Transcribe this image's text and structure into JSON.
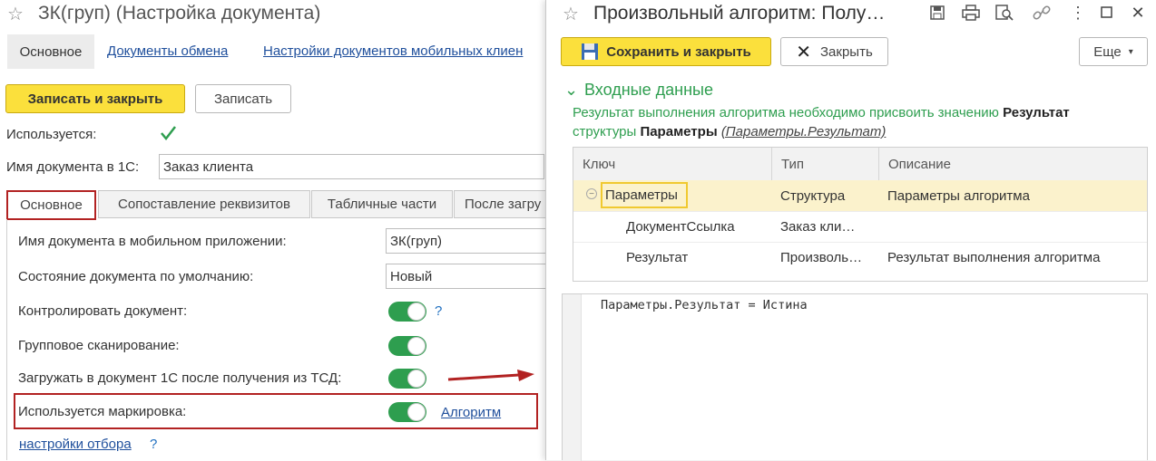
{
  "left": {
    "title": "ЗК(груп) (Настройка документа)",
    "top_tabs": [
      "Основное",
      "Документы обмена",
      "Настройки документов мобильных клиен"
    ],
    "buttons": {
      "save_close": "Записать и закрыть",
      "save": "Записать"
    },
    "used_label": "Используется:",
    "docname_label": "Имя документа в 1С:",
    "docname_value": "Заказ клиента",
    "tabs": [
      "Основное",
      "Сопоставление реквизитов",
      "Табличные части",
      "После загру"
    ],
    "rows": {
      "mobile_name_label": "Имя документа в мобильном приложении:",
      "mobile_name_value": "ЗК(груп)",
      "state_label": "Состояние документа по умолчанию:",
      "state_value": "Новый",
      "control_label": "Контролировать документ:",
      "control_help": "?",
      "group_scan_label": "Групповое сканирование:",
      "load_label": "Загружать в документ 1С после получения из ТСД:",
      "marking_label": "Используется маркировка:",
      "algorithm_link": "Алгоритм",
      "filter_link": "настройки отбора",
      "filter_help": "?"
    },
    "accent_color": "#b22222"
  },
  "right": {
    "title": "Произвольный алгоритм: Полу…",
    "buttons": {
      "save_close": "Сохранить и закрыть",
      "close": "Закрыть",
      "more": "Еще"
    },
    "section_title": "Входные данные",
    "desc_green_1": "Результат выполнения алгоритма необходимо присвоить значению ",
    "desc_bold_1": "Результат",
    "desc_green_2": "структуры ",
    "desc_bold_2": "Параметры",
    "desc_italic": "(Параметры.Результат)",
    "table": {
      "headers": [
        "Ключ",
        "Тип",
        "Описание"
      ],
      "rows": [
        {
          "key": "Параметры",
          "type": "Структура",
          "desc": "Параметры алгоритма"
        },
        {
          "key": "ДокументСсылка",
          "type": "Заказ кли…",
          "desc": ""
        },
        {
          "key": "Результат",
          "type": "Произволь…",
          "desc": "Результат выполнения алгоритма"
        }
      ]
    },
    "code": "Параметры.Результат = Истина",
    "icons": [
      "save-icon",
      "print-icon",
      "preview-icon",
      "link-icon",
      "more-icon",
      "minimize-icon",
      "close-icon"
    ]
  }
}
